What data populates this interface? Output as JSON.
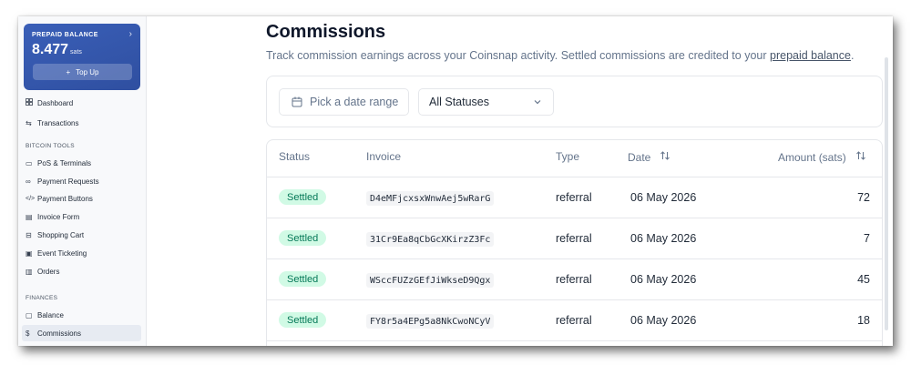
{
  "sidebar": {
    "balance": {
      "label": "PREPAID BALANCE",
      "amount": "8.477",
      "unit": "sats",
      "topup_label": "Top Up"
    },
    "items_top": [
      {
        "label": "Dashboard",
        "icon": "grid-icon"
      },
      {
        "label": "Transactions",
        "icon": "arrows-icon"
      }
    ],
    "section_bitcoin_tools": "BITCOIN TOOLS",
    "tools": [
      {
        "label": "PoS & Terminals",
        "icon": "monitor-icon"
      },
      {
        "label": "Payment Requests",
        "icon": "link-icon"
      },
      {
        "label": "Payment Buttons",
        "icon": "code-icon"
      },
      {
        "label": "Invoice Form",
        "icon": "document-icon"
      },
      {
        "label": "Shopping Cart",
        "icon": "cart-icon"
      },
      {
        "label": "Event Ticketing",
        "icon": "ticket-icon"
      },
      {
        "label": "Orders",
        "icon": "clipboard-icon"
      }
    ],
    "section_finances": "FINANCES",
    "finances": [
      {
        "label": "Balance",
        "icon": "wallet-icon"
      },
      {
        "label": "Commissions",
        "icon": "dollar-icon"
      }
    ]
  },
  "main": {
    "title": "Commissions",
    "description_prefix": "Track commission earnings across your Coinsnap activity. Settled commissions are credited to your ",
    "description_link": "prepaid balance",
    "description_suffix": ".",
    "filters": {
      "date_placeholder": "Pick a date range",
      "status_selected": "All Statuses"
    },
    "table": {
      "columns": [
        "Status",
        "Invoice",
        "Type",
        "Date",
        "Amount (sats)"
      ],
      "rows": [
        {
          "status": "Settled",
          "invoice": "D4eMFjcxsxWnwAej5wRarG",
          "type": "referral",
          "date": "06 May 2026",
          "amount": "72"
        },
        {
          "status": "Settled",
          "invoice": "31Cr9Ea8qCbGcXKirzZ3Fc",
          "type": "referral",
          "date": "06 May 2026",
          "amount": "7"
        },
        {
          "status": "Settled",
          "invoice": "WSccFUZzGEfJiWkseD9Qgx",
          "type": "referral",
          "date": "06 May 2026",
          "amount": "45"
        },
        {
          "status": "Settled",
          "invoice": "FY8r5a4EPg5a8NkCwoNCyV",
          "type": "referral",
          "date": "06 May 2026",
          "amount": "18"
        }
      ]
    }
  },
  "colors": {
    "brand_blue": "#3a5fb8",
    "settled_badge_bg": "#d1fae5",
    "settled_badge_text": "#047857",
    "active_nav_bg": "#e7ebf2"
  }
}
